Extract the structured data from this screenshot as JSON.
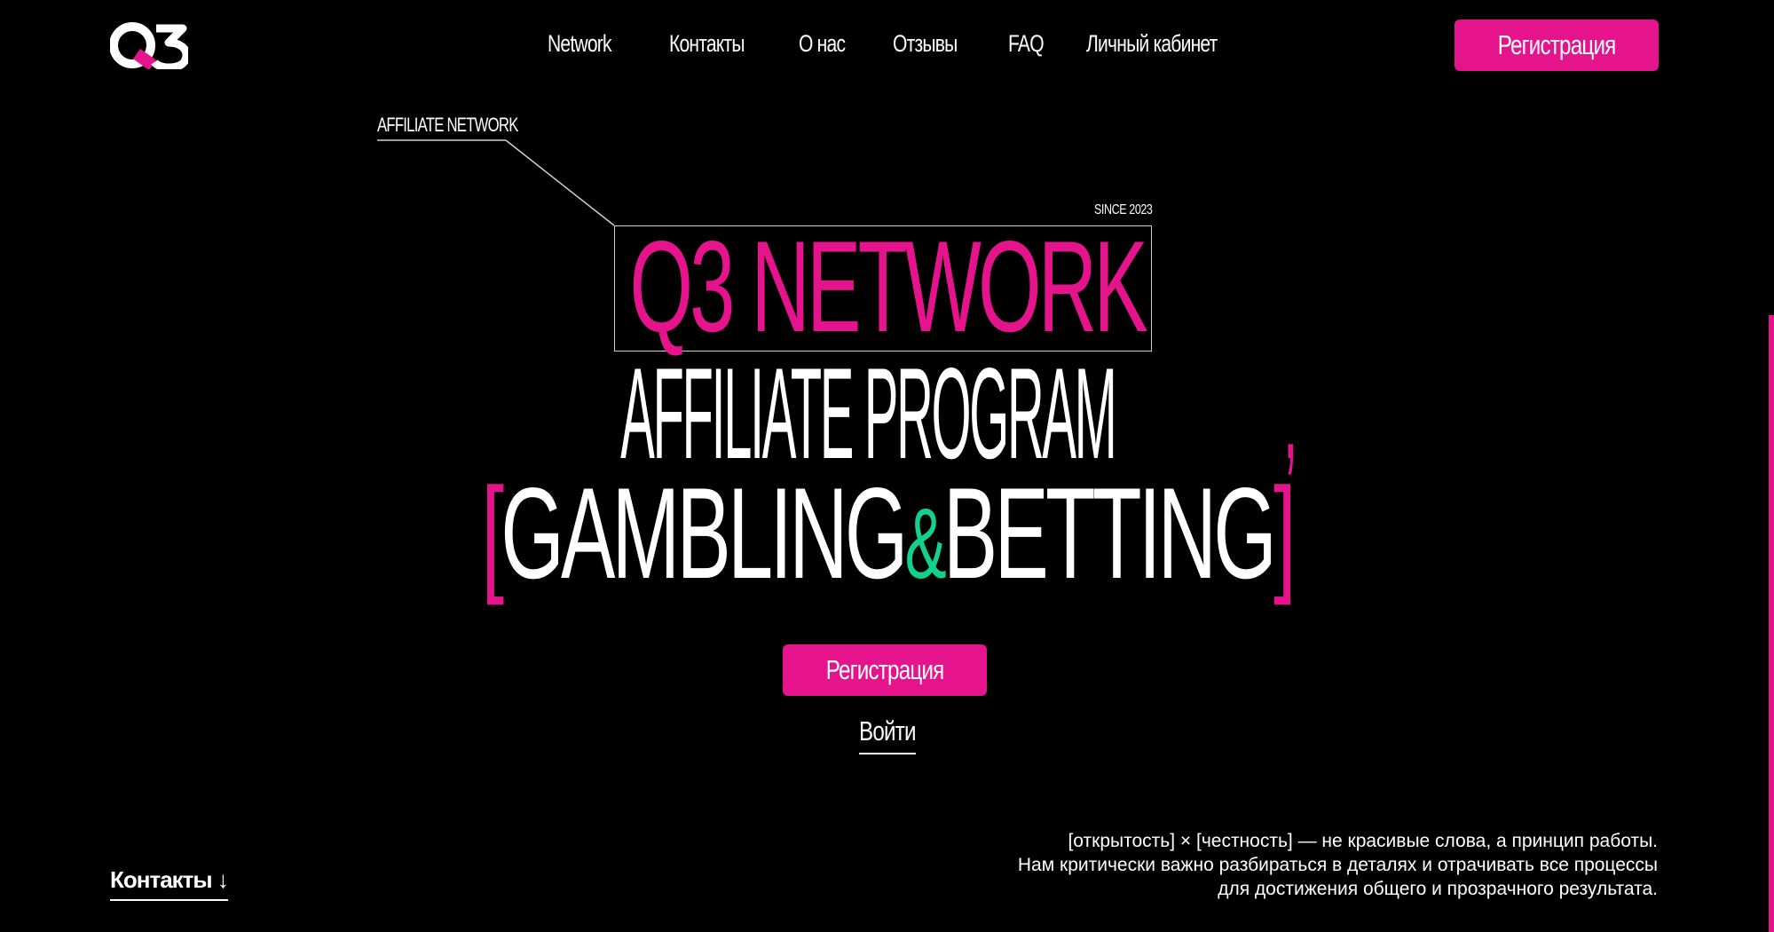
{
  "header": {
    "logo_text": "Q3",
    "nav": [
      "Network",
      "Контакты",
      "О нас",
      "Отзывы",
      "FAQ",
      "Личный кабинет"
    ],
    "register_label": "Регистрация"
  },
  "hero": {
    "label": "AFFILIATE NETWORK",
    "since": "SINCE 2023",
    "title_line1": "Q3 NETWORK",
    "title_line2": "AFFILIATE PROGRAM",
    "title_line2_comma": ",",
    "bracket_open": "[",
    "title_line3_a": "GAMBLING",
    "title_line3_amp": "&",
    "title_line3_b": "BETTING",
    "bracket_close": "]",
    "register_label": "Регистрация",
    "login_label": "Войти"
  },
  "footer": {
    "contacts_label": "Контакты ↓",
    "manifesto": [
      "[открытость] × [честность] — не красивые слова, а принцип работы.",
      "Нам критически важно разбираться в деталях и отрачивать все процессы",
      "для достижения общего и прозрачного результата."
    ]
  },
  "colors": {
    "accent": "#e5148c",
    "green": "#12d18e",
    "background": "#000000"
  }
}
